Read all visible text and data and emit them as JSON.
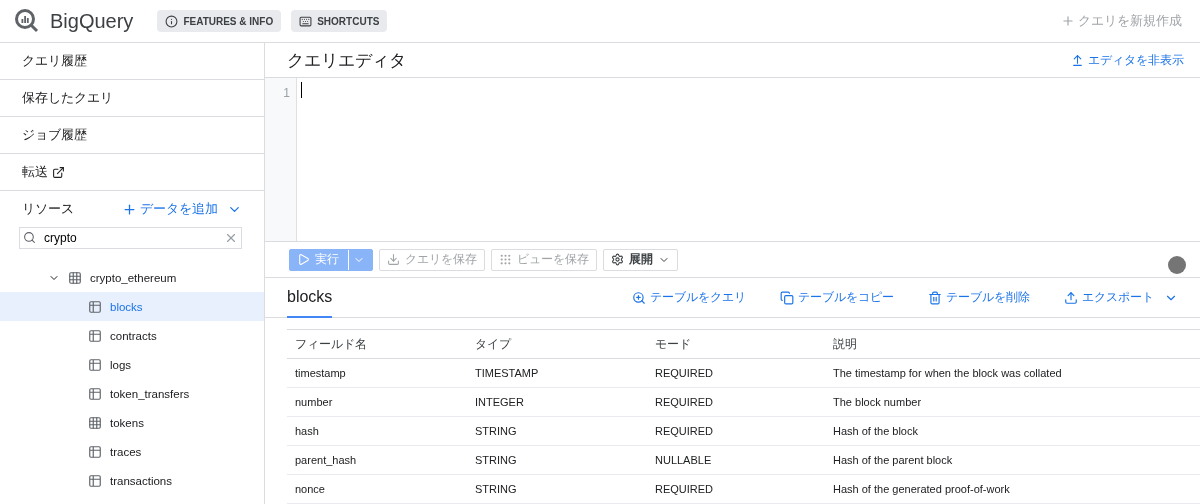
{
  "app": {
    "title": "BigQuery",
    "chips": [
      {
        "label": "FEATURES & INFO",
        "kind": "info"
      },
      {
        "label": "SHORTCUTS",
        "kind": "keyboard"
      }
    ],
    "new_query": {
      "label": "クエリを新規作成",
      "disabled": true
    }
  },
  "sidebar": {
    "nav": [
      {
        "label": "クエリ履歴",
        "external": false
      },
      {
        "label": "保存したクエリ",
        "external": false
      },
      {
        "label": "ジョブ履歴",
        "external": false
      },
      {
        "label": "転送",
        "external": true
      }
    ],
    "resources_label": "リソース",
    "add_data": "データを追加",
    "search": {
      "value": "crypto"
    },
    "tree": [
      {
        "label": "crypto_ethereum",
        "kind": "dataset",
        "expanded": true,
        "children": [
          {
            "label": "blocks",
            "kind": "table",
            "selected": true
          },
          {
            "label": "contracts",
            "kind": "table",
            "selected": false
          },
          {
            "label": "logs",
            "kind": "table",
            "selected": false
          },
          {
            "label": "token_transfers",
            "kind": "table",
            "selected": false
          },
          {
            "label": "tokens",
            "kind": "grid",
            "selected": false
          },
          {
            "label": "traces",
            "kind": "table",
            "selected": false
          },
          {
            "label": "transactions",
            "kind": "table",
            "selected": false
          }
        ]
      }
    ]
  },
  "editor": {
    "title": "クエリエディタ",
    "hide_label": "エディタを非表示",
    "line_numbers": [
      "1"
    ]
  },
  "toolbar": [
    {
      "label": "実行",
      "kind": "run",
      "disabled": false
    },
    {
      "label": "クエリを保存",
      "kind": "download",
      "disabled": true
    },
    {
      "label": "ビューを保存",
      "kind": "grid",
      "disabled": true
    },
    {
      "label": "展開",
      "kind": "gear",
      "disabled": false
    }
  ],
  "details": {
    "table_name": "blocks",
    "actions": [
      {
        "label": "テーブルをクエリ",
        "kind": "query"
      },
      {
        "label": "テーブルをコピー",
        "kind": "copy"
      },
      {
        "label": "テーブルを削除",
        "kind": "delete"
      },
      {
        "label": "エクスポート",
        "kind": "export"
      }
    ],
    "columns": [
      "フィールド名",
      "タイプ",
      "モード",
      "説明"
    ],
    "rows": [
      [
        "timestamp",
        "TIMESTAMP",
        "REQUIRED",
        "The timestamp for when the block was collated"
      ],
      [
        "number",
        "INTEGER",
        "REQUIRED",
        "The block number"
      ],
      [
        "hash",
        "STRING",
        "REQUIRED",
        "Hash of the block"
      ],
      [
        "parent_hash",
        "STRING",
        "NULLABLE",
        "Hash of the parent block"
      ],
      [
        "nonce",
        "STRING",
        "REQUIRED",
        "Hash of the generated proof-of-work"
      ]
    ]
  }
}
